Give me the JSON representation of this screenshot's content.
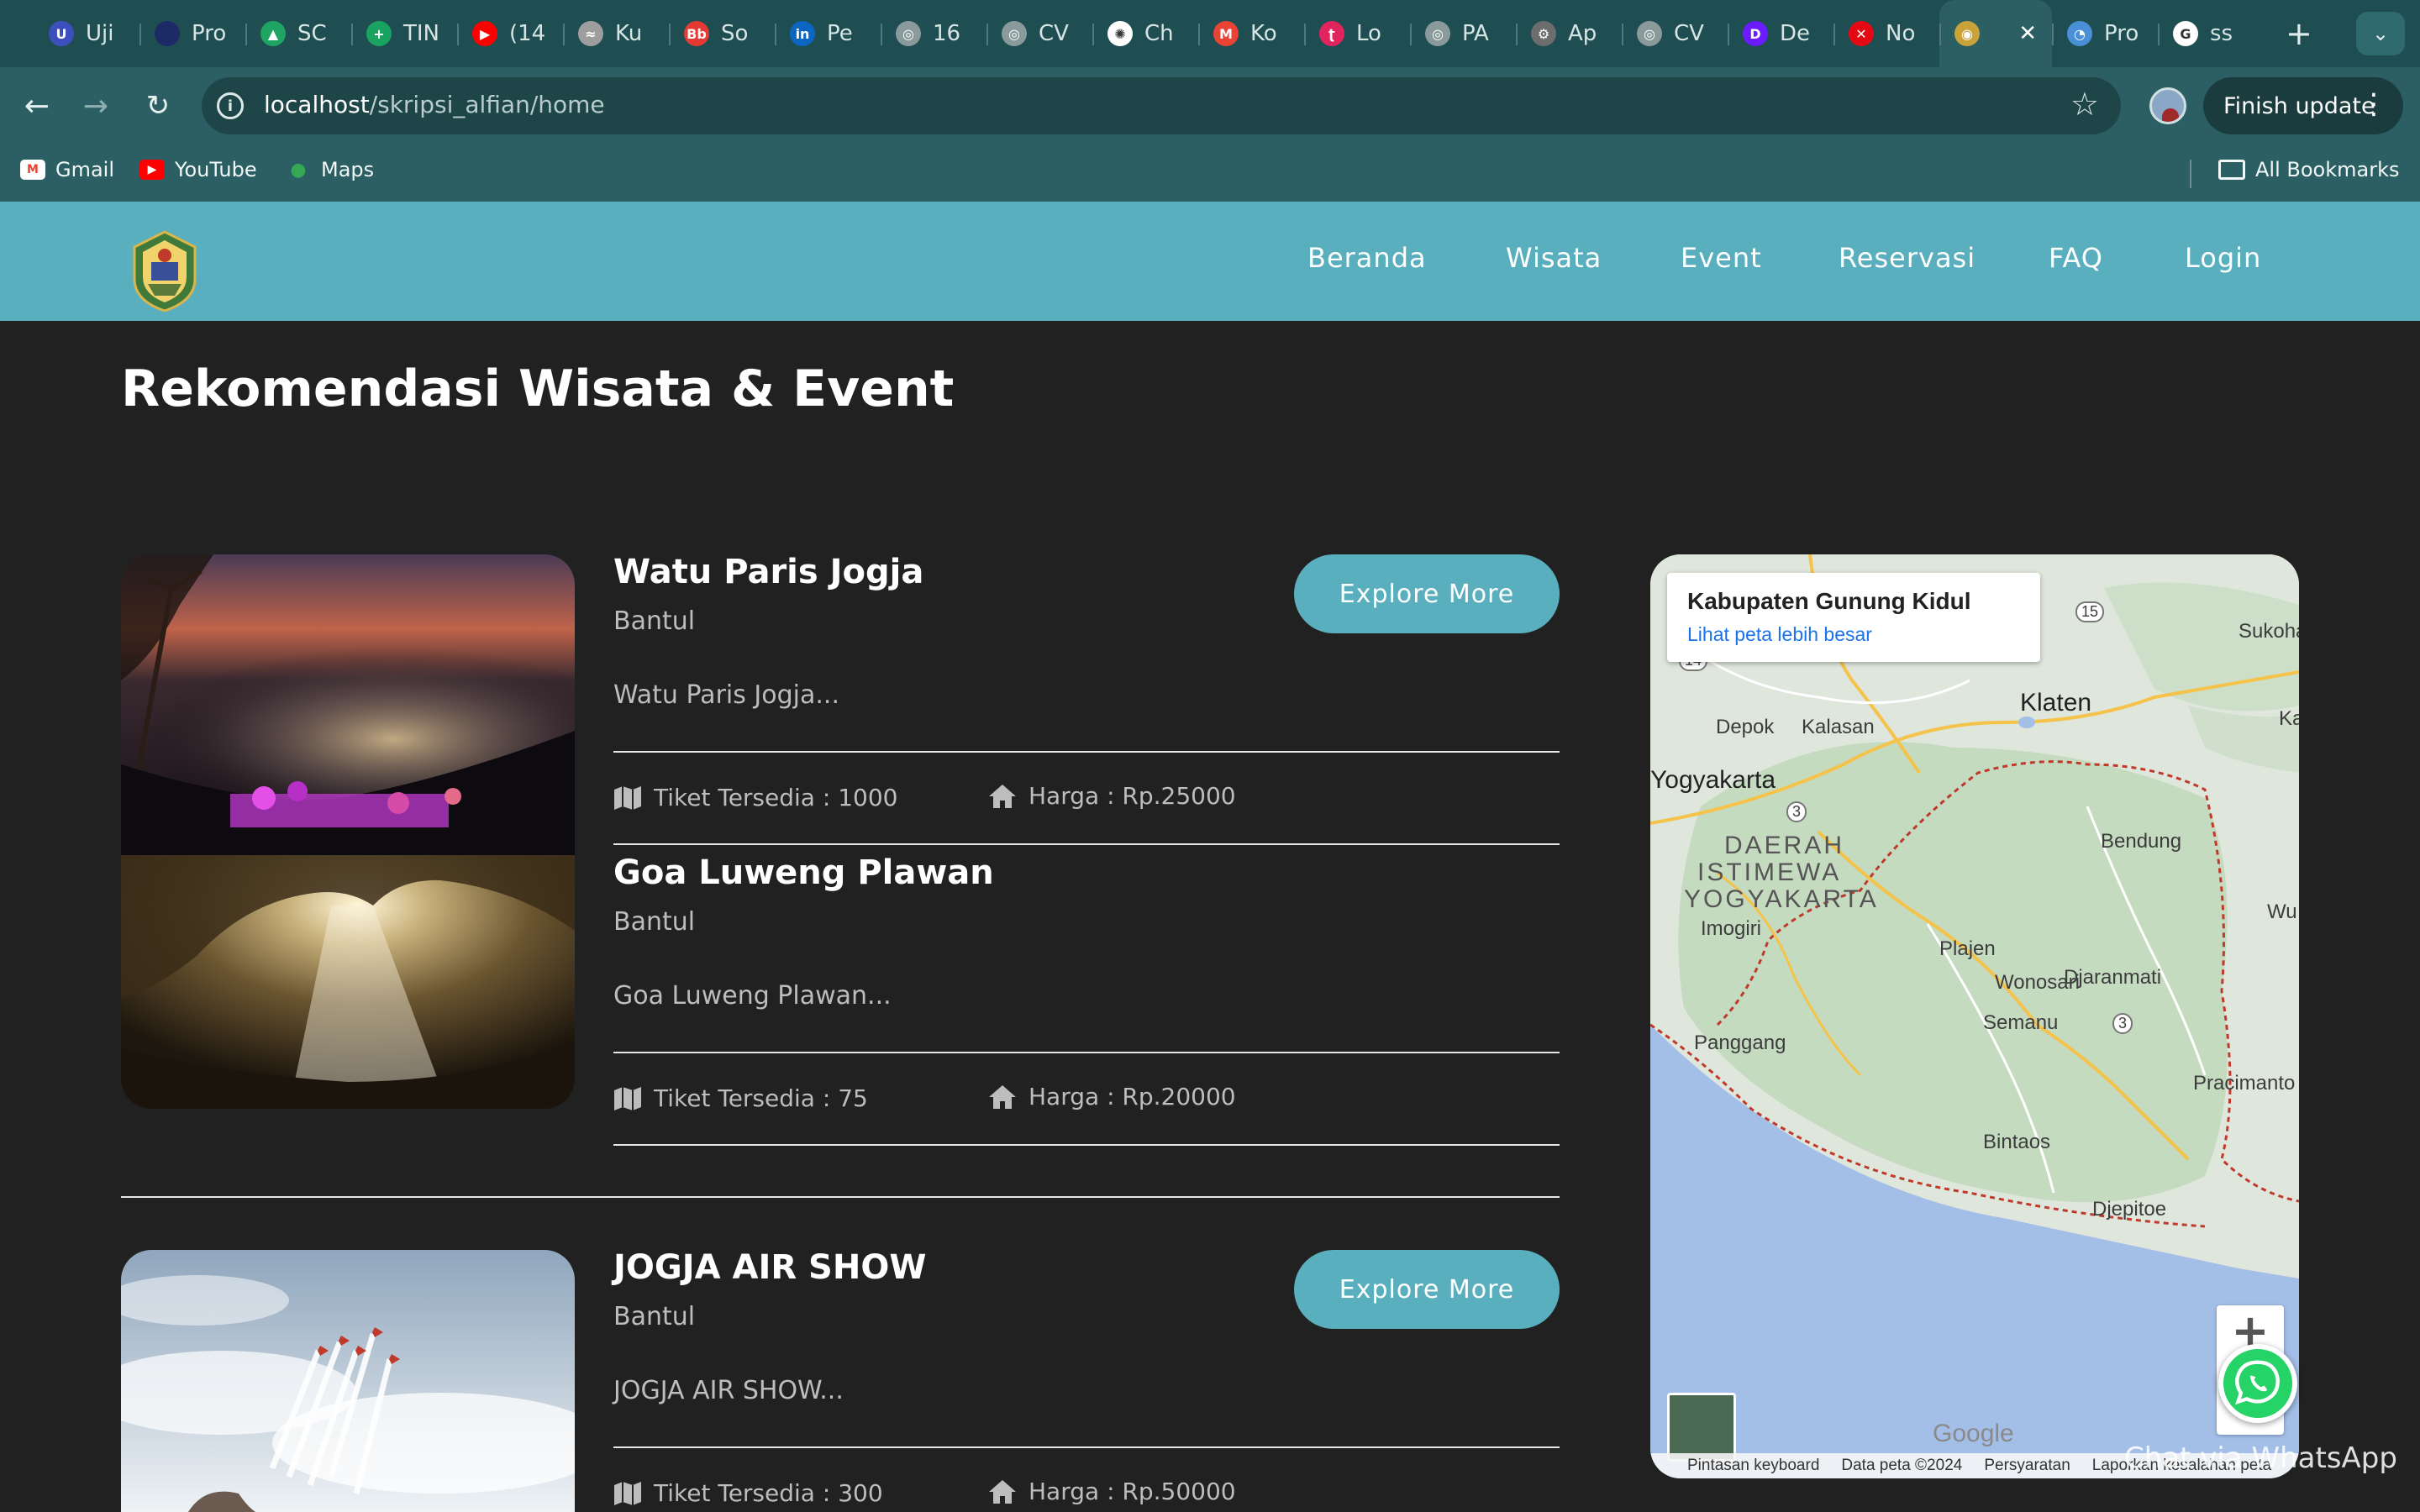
{
  "browser": {
    "tabs": [
      {
        "label": "Uji",
        "color": "#3d4fbf",
        "glyph": "U",
        "icon": "university-icon"
      },
      {
        "label": "Pro",
        "color": "#1c2a66",
        "glyph": "",
        "icon": "globe-dark-icon"
      },
      {
        "label": "SC",
        "color": "#1fa463",
        "glyph": "▲",
        "icon": "drive-icon"
      },
      {
        "label": "TIN",
        "color": "#1aa260",
        "glyph": "+",
        "icon": "sheets-icon"
      },
      {
        "label": "(14",
        "color": "#ff0000",
        "glyph": "▶",
        "icon": "youtube-icon"
      },
      {
        "label": "Ku",
        "color": "#9e9e9e",
        "glyph": "≈",
        "icon": "hat-icon"
      },
      {
        "label": "So",
        "color": "#e53935",
        "glyph": "Bb",
        "icon": "blackboard-icon"
      },
      {
        "label": "Pe",
        "color": "#0a66c2",
        "glyph": "in",
        "icon": "linkedin-icon"
      },
      {
        "label": "16",
        "color": "#8a9a9b",
        "glyph": "◎",
        "icon": "globe-icon"
      },
      {
        "label": "CV",
        "color": "#8a9a9b",
        "glyph": "◎",
        "icon": "globe-icon"
      },
      {
        "label": "Ch",
        "color": "#ffffff",
        "glyph": "✺",
        "icon": "chatgpt-icon"
      },
      {
        "label": "Ko",
        "color": "#ea4335",
        "glyph": "M",
        "icon": "gmail-icon"
      },
      {
        "label": "Lo",
        "color": "#e0245e",
        "glyph": "ʈ",
        "icon": "telkom-icon"
      },
      {
        "label": "PA",
        "color": "#8a9a9b",
        "glyph": "◎",
        "icon": "globe-icon"
      },
      {
        "label": "Ap",
        "color": "#6d6d6d",
        "glyph": "⚙",
        "icon": "seal-icon"
      },
      {
        "label": "CV",
        "color": "#8a9a9b",
        "glyph": "◎",
        "icon": "globe-icon"
      },
      {
        "label": "De",
        "color": "#6a1bff",
        "glyph": "D",
        "icon": "dealls-icon"
      },
      {
        "label": "No",
        "color": "#e50914",
        "glyph": "✕",
        "icon": "netflix-icon"
      },
      {
        "label": "",
        "color": "#c9a23a",
        "glyph": "◉",
        "icon": "gunungkidul-icon",
        "active": true
      },
      {
        "label": "Pro",
        "color": "#4a90d9",
        "glyph": "◔",
        "icon": "chrome-dev-icon"
      },
      {
        "label": "ss",
        "color": "#ffffff",
        "glyph": "G",
        "icon": "google-icon"
      }
    ],
    "url_host": "localhost",
    "url_path": "/skripsi_alfian/home",
    "finish_update": "Finish update",
    "bookmarks": [
      {
        "label": "Gmail",
        "icon": "gmail-icon",
        "color": "#ea4335",
        "glyph": "M"
      },
      {
        "label": "YouTube",
        "icon": "youtube-icon",
        "color": "#ff0000",
        "glyph": "▶"
      },
      {
        "label": "Maps",
        "icon": "maps-pin-icon",
        "color": "#34a853",
        "glyph": "●"
      }
    ],
    "all_bookmarks": "All Bookmarks"
  },
  "site": {
    "nav": [
      "Beranda",
      "Wisata",
      "Event",
      "Reservasi",
      "FAQ",
      "Login"
    ],
    "section_title": "Rekomendasi Wisata & Event",
    "explore_label": "Explore More",
    "items": [
      {
        "title": "Watu Paris Jogja",
        "location": "Bantul",
        "desc": "Watu Paris Jogja...",
        "tickets": "Tiket Tersedia : 1000",
        "price": "Harga : Rp.25000"
      },
      {
        "title": "Goa Luweng Plawan",
        "location": "Bantul",
        "desc": "Goa Luweng Plawan...",
        "tickets": "Tiket Tersedia : 75",
        "price": "Harga : Rp.20000"
      },
      {
        "title": "JOGJA AIR SHOW",
        "location": "Bantul",
        "desc": "JOGJA AIR SHOW...",
        "tickets": "Tiket Tersedia : 300",
        "price": "Harga : Rp.50000"
      }
    ],
    "whatsapp": "Chat via WhatsApp"
  },
  "map": {
    "info_title": "Kabupaten Gunung Kidul",
    "info_link": "Lihat peta lebih besar",
    "labels": {
      "depok": "Depok",
      "kalasan": "Kalasan",
      "klaten": "Klaten",
      "yogyakarta": "Yogyakarta",
      "daerah": "DAERAH",
      "istimewa": "ISTIMEWA",
      "yogya": "YOGYAKARTA",
      "imogiri": "Imogiri",
      "bendung": "Bendung",
      "plajen": "Plajen",
      "wonosari": "Wonosari",
      "djaranmati": "Djaranmati",
      "semanu": "Semanu",
      "panggang": "Panggang",
      "bintaos": "Bintaos",
      "pracimanto": "Pracimanto",
      "djepitoe": "Djepitoe",
      "sukoha": "Sukoha",
      "ka": "Ka",
      "wu": "Wu",
      "route15": "15",
      "route14": "14",
      "route3a": "3",
      "route3b": "3"
    },
    "google": "Google",
    "footer": [
      "Pintasan keyboard",
      "Data peta ©2024",
      "Persyaratan",
      "Laporkan kesalahan peta"
    ]
  }
}
